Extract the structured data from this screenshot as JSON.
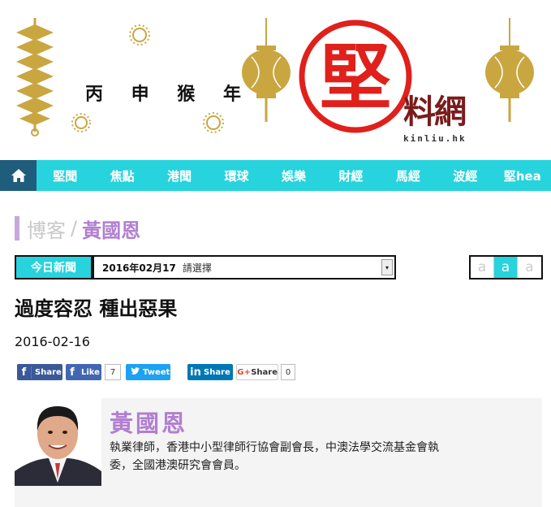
{
  "banner": {
    "slogan": [
      "丙",
      "申",
      "猴",
      "年"
    ],
    "logo_char": "堅",
    "brand_zh": "料網",
    "brand_domain": "kinliu.hk",
    "colors": {
      "gold": "#c9a640",
      "red": "#e0201b",
      "maroon": "#7a1c1c"
    }
  },
  "nav": {
    "home_icon": "home-icon",
    "items": [
      "堅聞",
      "焦點",
      "港聞",
      "環球",
      "娛樂",
      "財經",
      "馬經",
      "波經",
      "堅hea"
    ],
    "colors": {
      "bar": "#27d3dd",
      "home_bg": "#1f5d7d"
    }
  },
  "breadcrumb": {
    "blog": "博客",
    "separator": "/",
    "author": "黃國恩"
  },
  "date_row": {
    "today_label": "今日新聞",
    "selected_date": "2016年02月17",
    "placeholder": "請選擇",
    "font_sizes": [
      "a",
      "a",
      "a"
    ]
  },
  "article": {
    "title": "過度容忍 種出惡果",
    "date": "2016-02-16"
  },
  "share": {
    "fb_share": "Share",
    "fb_like": "Like",
    "fb_like_count": "7",
    "tweet": "Tweet",
    "linkedin": "Share",
    "gplus": "Share",
    "gplus_count": "0"
  },
  "author": {
    "name": "黃國恩",
    "bio": "執業律師，香港中小型律師行協會副會長，中澳法學交流基金會執委，全國港澳研究會會員。"
  }
}
